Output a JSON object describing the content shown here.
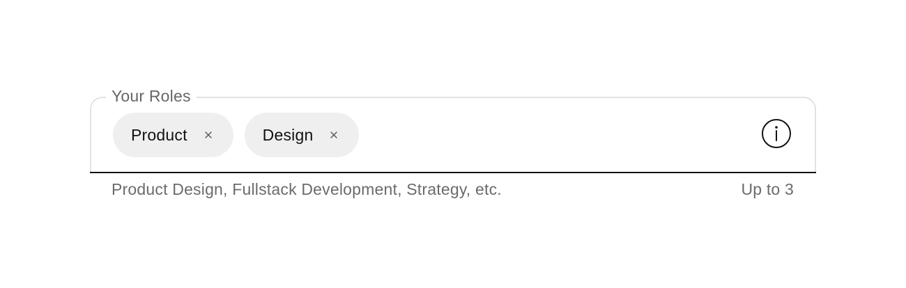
{
  "field": {
    "label": "Your Roles",
    "chips": [
      {
        "label": "Product",
        "remove_icon": "close-icon"
      },
      {
        "label": "Design",
        "remove_icon": "close-icon"
      }
    ],
    "info_icon": "info-icon",
    "helper_text": "Product Design, Fullstack Development, Strategy, etc.",
    "limit_text": "Up to 3"
  },
  "colors": {
    "border": "#e2e2e2",
    "underline": "#111111",
    "chip_background": "#efefef",
    "muted_text": "#666666",
    "text": "#111111"
  }
}
